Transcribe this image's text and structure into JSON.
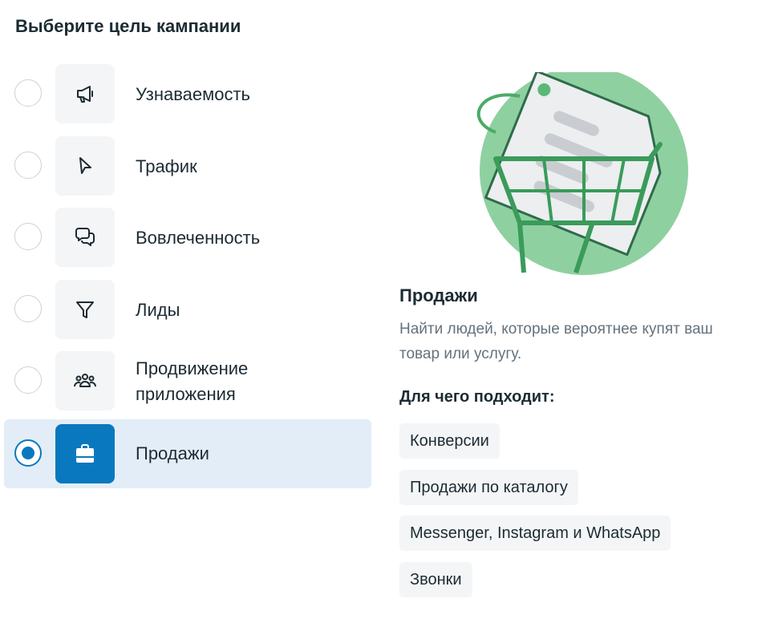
{
  "heading": "Выберите цель кампании",
  "objectives": [
    {
      "label": "Узнаваемость",
      "icon": "megaphone-icon",
      "selected": false
    },
    {
      "label": "Трафик",
      "icon": "cursor-icon",
      "selected": false
    },
    {
      "label": "Вовлеченность",
      "icon": "chat-bubbles-icon",
      "selected": false
    },
    {
      "label": "Лиды",
      "icon": "funnel-icon",
      "selected": false
    },
    {
      "label": "Продвижение приложения",
      "icon": "people-group-icon",
      "selected": false
    },
    {
      "label": "Продажи",
      "icon": "shopping-bag-icon",
      "selected": true
    }
  ],
  "detail": {
    "title": "Продажи",
    "description": "Найти людей, которые вероятнее купят ваш товар или услугу.",
    "suitable_heading": "Для чего подходит:",
    "chips": [
      "Конверсии",
      "Продажи по каталогу",
      "Messenger, Instagram и WhatsApp",
      "Звонки"
    ]
  },
  "colors": {
    "accent": "#0a78be",
    "selected_bg": "#e3edf7",
    "illustration_green": "#8fd0a0",
    "text": "#1c2b33",
    "muted_text": "#65727c"
  }
}
